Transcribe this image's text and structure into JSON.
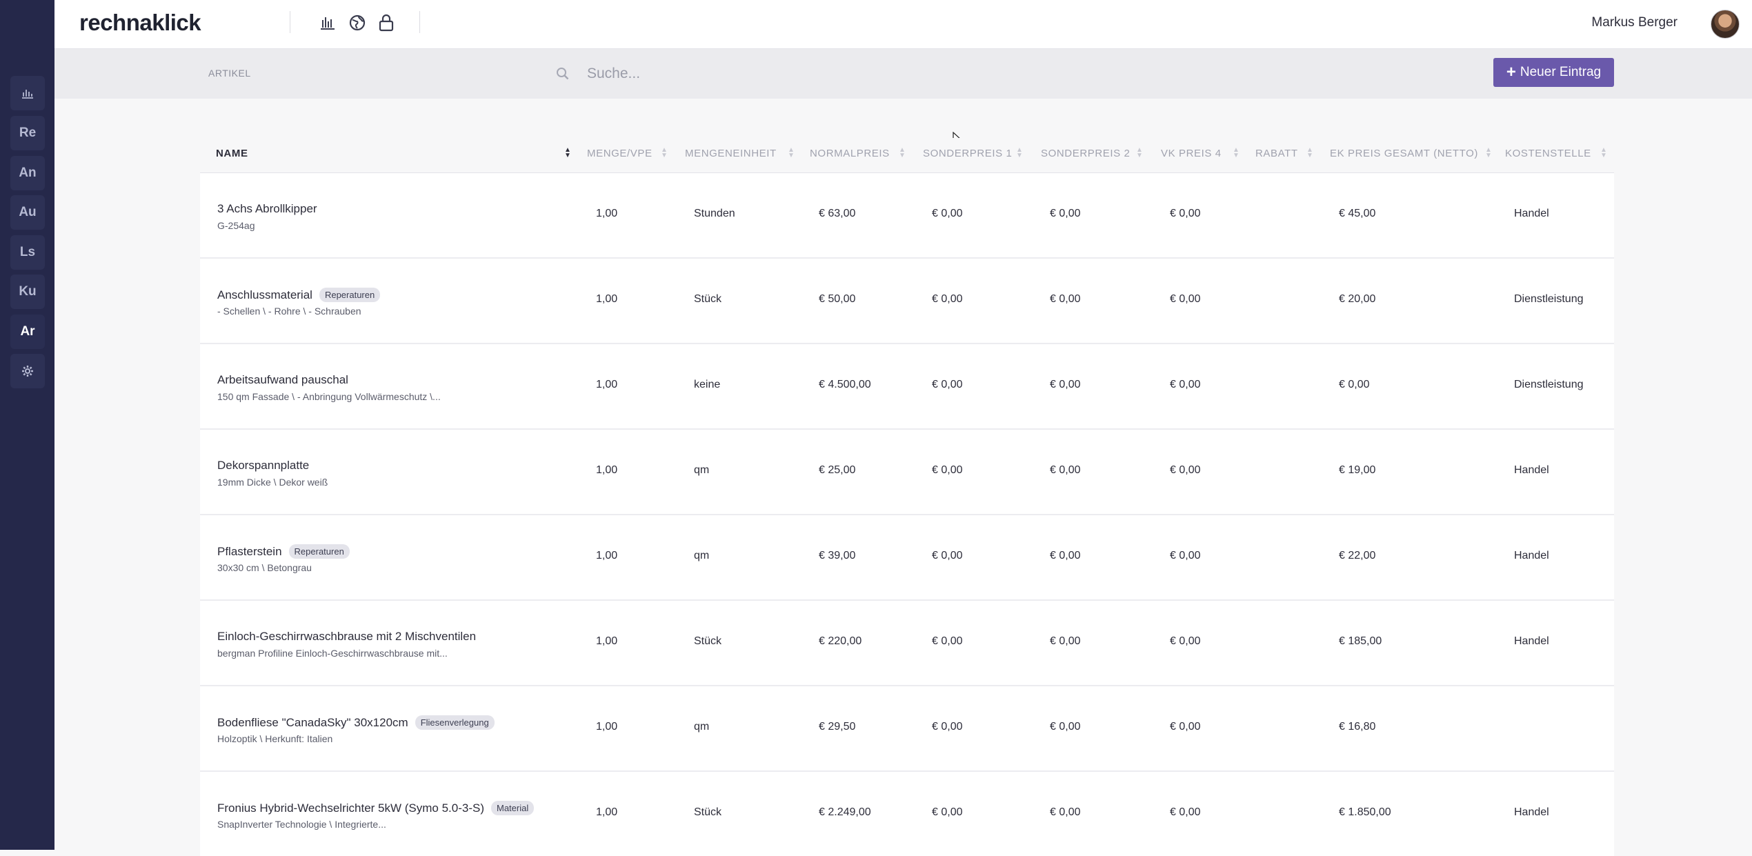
{
  "app": {
    "logo": "rechnaklick",
    "user_name": "Markus Berger"
  },
  "sidebar": {
    "items": [
      {
        "label": "",
        "icon": "chart-icon"
      },
      {
        "label": "Re"
      },
      {
        "label": "An"
      },
      {
        "label": "Au"
      },
      {
        "label": "Ls"
      },
      {
        "label": "Ku"
      },
      {
        "label": "Ar",
        "active": true
      },
      {
        "label": "",
        "icon": "gear-icon"
      }
    ]
  },
  "topbar": {
    "icons": [
      "bar-chart-icon",
      "globe-icon",
      "lock-icon"
    ]
  },
  "subbar": {
    "section": "ARTIKEL",
    "search_placeholder": "Suche...",
    "new_button": "Neuer Eintrag"
  },
  "colors": {
    "sidebar": "#25284a",
    "accent": "#6a59ab"
  },
  "table": {
    "columns": [
      "NAME",
      "MENGE/VPE",
      "MENGENEINHEIT",
      "NORMALPREIS",
      "SONDERPREIS 1",
      "SONDERPREIS 2",
      "VK PREIS 4",
      "RABATT",
      "EK PREIS GESAMT (NETTO)",
      "KOSTENSTELLE"
    ],
    "sorted_column": "NAME",
    "rows": [
      {
        "name": "3 Achs Abrollkipper",
        "tag": "",
        "desc": "G-254ag",
        "menge": "1,00",
        "einheit": "Stunden",
        "normal": "€ 63,00",
        "sp1": "€ 0,00",
        "sp2": "€ 0,00",
        "vk4": "€ 0,00",
        "rabatt": "",
        "ek": "€ 45,00",
        "kst": "Handel"
      },
      {
        "name": "Anschlussmaterial",
        "tag": "Reperaturen",
        "desc": "- Schellen \\ - Rohre \\ - Schrauben",
        "menge": "1,00",
        "einheit": "Stück",
        "normal": "€ 50,00",
        "sp1": "€ 0,00",
        "sp2": "€ 0,00",
        "vk4": "€ 0,00",
        "rabatt": "",
        "ek": "€ 20,00",
        "kst": "Dienstleistung"
      },
      {
        "name": "Arbeitsaufwand pauschal",
        "tag": "",
        "desc": "150 qm Fassade \\ - Anbringung Vollwärmeschutz \\...",
        "menge": "1,00",
        "einheit": "keine",
        "normal": "€ 4.500,00",
        "sp1": "€ 0,00",
        "sp2": "€ 0,00",
        "vk4": "€ 0,00",
        "rabatt": "",
        "ek": "€ 0,00",
        "kst": "Dienstleistung"
      },
      {
        "name": "Dekorspannplatte",
        "tag": "",
        "desc": "19mm Dicke \\ Dekor weiß",
        "menge": "1,00",
        "einheit": "qm",
        "normal": "€ 25,00",
        "sp1": "€ 0,00",
        "sp2": "€ 0,00",
        "vk4": "€ 0,00",
        "rabatt": "",
        "ek": "€ 19,00",
        "kst": "Handel"
      },
      {
        "name": "Pflasterstein",
        "tag": "Reperaturen",
        "desc": "30x30 cm \\ Betongrau",
        "menge": "1,00",
        "einheit": "qm",
        "normal": "€ 39,00",
        "sp1": "€ 0,00",
        "sp2": "€ 0,00",
        "vk4": "€ 0,00",
        "rabatt": "",
        "ek": "€ 22,00",
        "kst": "Handel"
      },
      {
        "name": "Einloch-Geschirrwaschbrause mit 2 Mischventilen",
        "tag": "",
        "desc": "bergman Profiline Einloch-Geschirrwaschbrause mit...",
        "menge": "1,00",
        "einheit": "Stück",
        "normal": "€ 220,00",
        "sp1": "€ 0,00",
        "sp2": "€ 0,00",
        "vk4": "€ 0,00",
        "rabatt": "",
        "ek": "€ 185,00",
        "kst": "Handel"
      },
      {
        "name": "Bodenfliese \"CanadaSky\" 30x120cm",
        "tag": "Fliesenverlegung",
        "desc": "Holzoptik \\ Herkunft: Italien",
        "menge": "1,00",
        "einheit": "qm",
        "normal": "€ 29,50",
        "sp1": "€ 0,00",
        "sp2": "€ 0,00",
        "vk4": "€ 0,00",
        "rabatt": "",
        "ek": "€ 16,80",
        "kst": ""
      },
      {
        "name": "Fronius Hybrid-Wechselrichter 5kW (Symo 5.0-3-S)",
        "tag": "Material",
        "desc": "SnapInverter Technologie \\ Integrierte...",
        "menge": "1,00",
        "einheit": "Stück",
        "normal": "€ 2.249,00",
        "sp1": "€ 0,00",
        "sp2": "€ 0,00",
        "vk4": "€ 0,00",
        "rabatt": "",
        "ek": "€ 1.850,00",
        "kst": "Handel"
      }
    ]
  }
}
